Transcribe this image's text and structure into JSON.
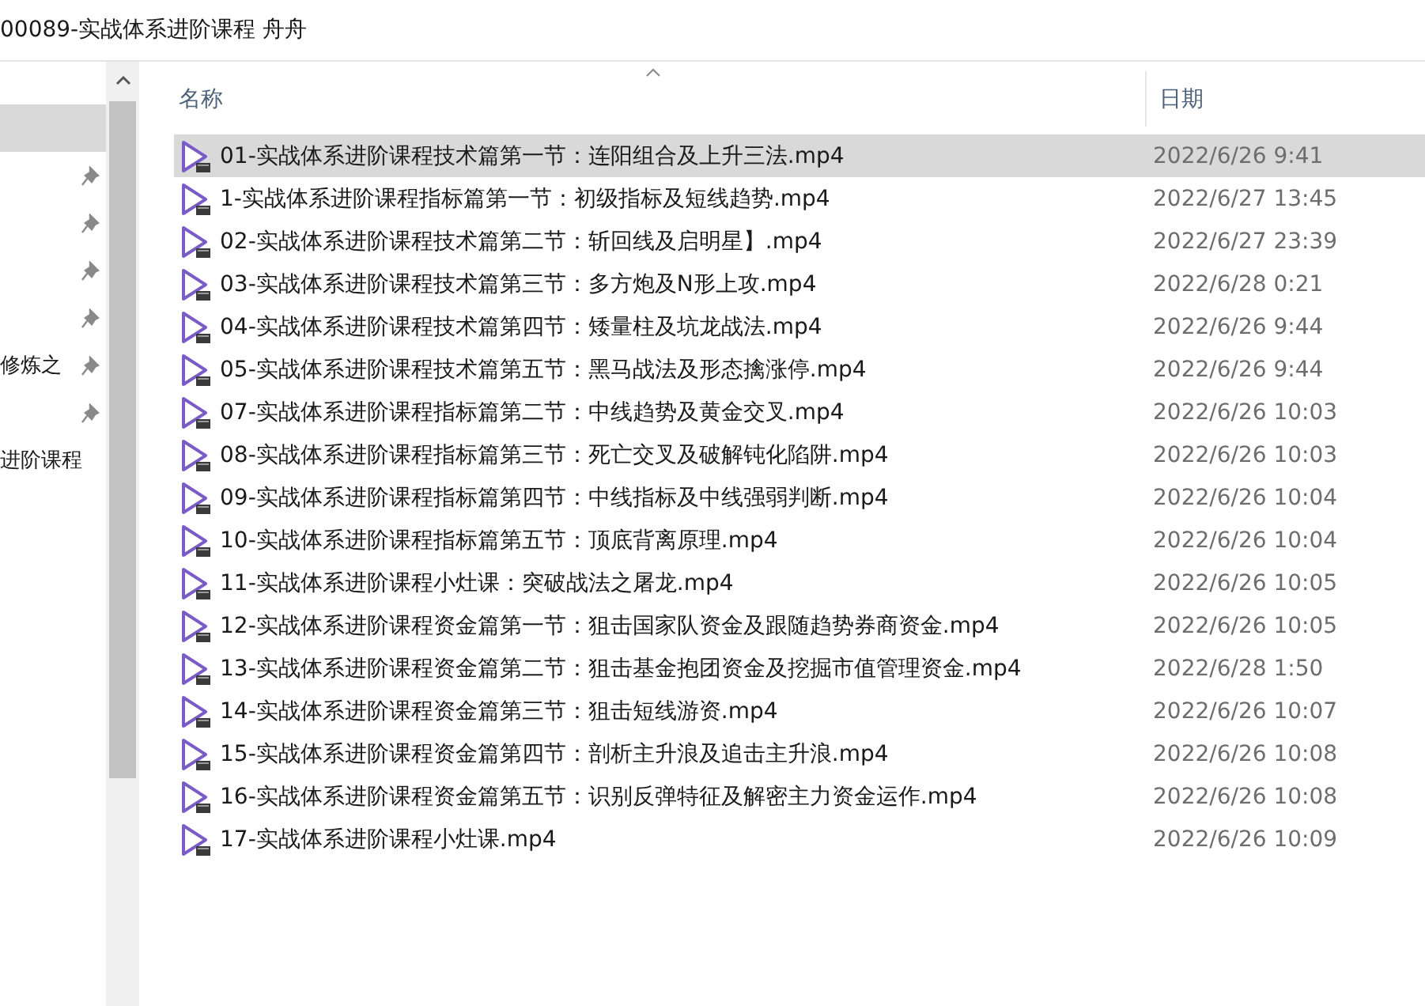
{
  "window": {
    "title": "00089-实战体系进阶课程 舟舟"
  },
  "sidebar": {
    "items": [
      {
        "selected": true,
        "pinned": false
      },
      {
        "selected": false,
        "pinned": true
      },
      {
        "selected": false,
        "pinned": true
      },
      {
        "selected": false,
        "pinned": true
      },
      {
        "selected": false,
        "pinned": true
      },
      {
        "selected": false,
        "pinned": true,
        "label": "修炼之"
      },
      {
        "selected": false,
        "pinned": true
      },
      {
        "selected": false,
        "pinned": false,
        "label": "进阶课程"
      }
    ]
  },
  "table": {
    "columns": [
      "名称",
      "日期"
    ],
    "rows": [
      {
        "name": "01-实战体系进阶课程技术篇第一节：连阳组合及上升三法.mp4",
        "date": "2022/6/26 9:41",
        "selected": true
      },
      {
        "name": "1-实战体系进阶课程指标篇第一节：初级指标及短线趋势.mp4",
        "date": "2022/6/27 13:45",
        "selected": false
      },
      {
        "name": "02-实战体系进阶课程技术篇第二节：斩回线及启明星】.mp4",
        "date": "2022/6/27 23:39",
        "selected": false
      },
      {
        "name": "03-实战体系进阶课程技术篇第三节：多方炮及N形上攻.mp4",
        "date": "2022/6/28 0:21",
        "selected": false
      },
      {
        "name": "04-实战体系进阶课程技术篇第四节：矮量柱及坑龙战法.mp4",
        "date": "2022/6/26 9:44",
        "selected": false
      },
      {
        "name": "05-实战体系进阶课程技术篇第五节：黑马战法及形态擒涨停.mp4",
        "date": "2022/6/26 9:44",
        "selected": false
      },
      {
        "name": "07-实战体系进阶课程指标篇第二节：中线趋势及黄金交叉.mp4",
        "date": "2022/6/26 10:03",
        "selected": false
      },
      {
        "name": "08-实战体系进阶课程指标篇第三节：死亡交叉及破解钝化陷阱.mp4",
        "date": "2022/6/26 10:03",
        "selected": false
      },
      {
        "name": "09-实战体系进阶课程指标篇第四节：中线指标及中线强弱判断.mp4",
        "date": "2022/6/26 10:04",
        "selected": false
      },
      {
        "name": "10-实战体系进阶课程指标篇第五节：顶底背离原理.mp4",
        "date": "2022/6/26 10:04",
        "selected": false
      },
      {
        "name": "11-实战体系进阶课程小灶课：突破战法之屠龙.mp4",
        "date": "2022/6/26 10:05",
        "selected": false
      },
      {
        "name": "12-实战体系进阶课程资金篇第一节：狙击国家队资金及跟随趋势券商资金.mp4",
        "date": "2022/6/26 10:05",
        "selected": false
      },
      {
        "name": "13-实战体系进阶课程资金篇第二节：狙击基金抱团资金及挖掘市值管理资金.mp4",
        "date": "2022/6/28 1:50",
        "selected": false
      },
      {
        "name": "14-实战体系进阶课程资金篇第三节：狙击短线游资.mp4",
        "date": "2022/6/26 10:07",
        "selected": false
      },
      {
        "name": "15-实战体系进阶课程资金篇第四节：剖析主升浪及追击主升浪.mp4",
        "date": "2022/6/26 10:08",
        "selected": false
      },
      {
        "name": "16-实战体系进阶课程资金篇第五节：识别反弹特征及解密主力资金运作.mp4",
        "date": "2022/6/26 10:08",
        "selected": false
      },
      {
        "name": "17-实战体系进阶课程小灶课.mp4",
        "date": "2022/6/26 10:09",
        "selected": false
      }
    ]
  }
}
